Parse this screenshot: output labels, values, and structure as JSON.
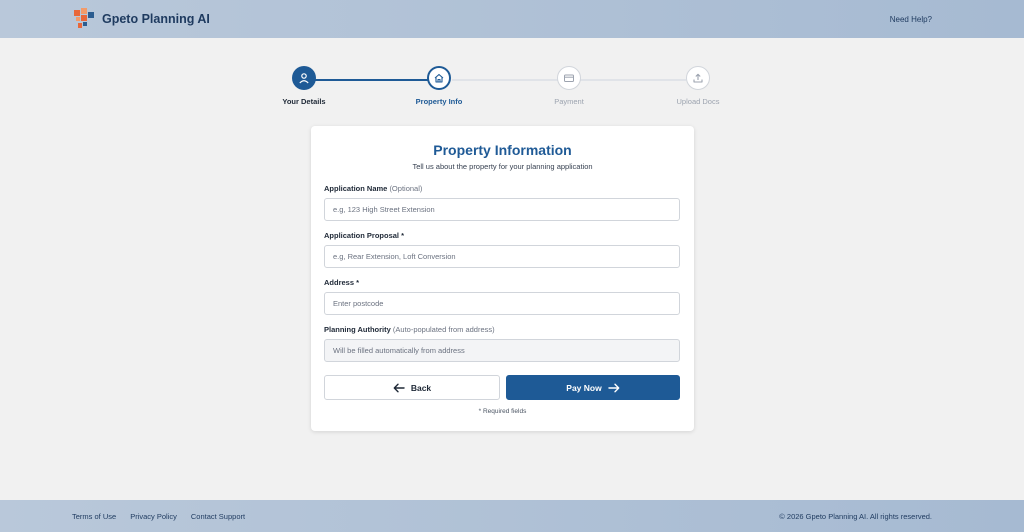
{
  "header": {
    "brand_name": "Gpeto Planning AI",
    "help_link": "Need Help?"
  },
  "stepper": {
    "steps": [
      {
        "label": "Your Details",
        "icon": "user-icon",
        "state": "completed"
      },
      {
        "label": "Property Info",
        "icon": "home-icon",
        "state": "active"
      },
      {
        "label": "Payment",
        "icon": "credit-card-icon",
        "state": "inactive"
      },
      {
        "label": "Upload Docs",
        "icon": "upload-icon",
        "state": "inactive"
      }
    ]
  },
  "form": {
    "title": "Property Information",
    "subtitle": "Tell us about the property for your planning application",
    "fields": [
      {
        "label": "Application Name",
        "hint": "(Optional)",
        "placeholder": "e.g, 123 High Street Extension",
        "value": ""
      },
      {
        "label": "Application Proposal *",
        "hint": "",
        "placeholder": "e.g, Rear Extension, Loft Conversion",
        "value": ""
      },
      {
        "label": "Address *",
        "hint": "",
        "placeholder": "Enter postcode",
        "value": ""
      },
      {
        "label": "Planning Authority",
        "hint": "(Auto-populated from address)",
        "placeholder": "Will be filled automatically from address",
        "value": ""
      }
    ],
    "back_label": "Back",
    "pay_label": "Pay Now",
    "required_note": "* Required fields"
  },
  "footer": {
    "links": [
      "Terms of Use",
      "Privacy Policy",
      "Contact Support"
    ],
    "copyright": "© 2026 Gpeto Planning AI. All rights reserved."
  },
  "colors": {
    "primary": "#1e5a96",
    "header_bg": "#b0c2d8",
    "inactive": "#d1d5db"
  }
}
